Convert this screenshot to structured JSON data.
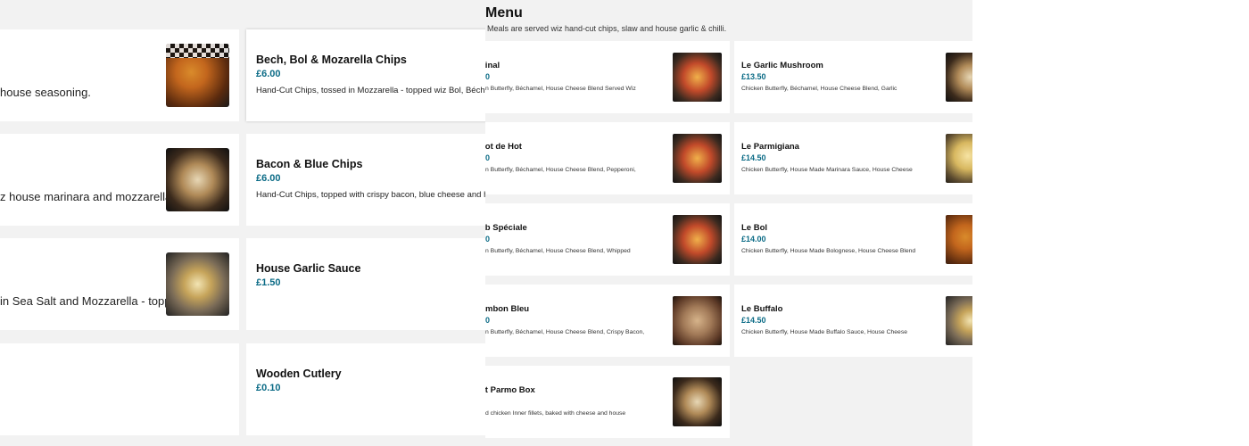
{
  "left": {
    "cards": [
      {
        "title": "Bech, Bol & Mozarella Chips",
        "price": "£6.00",
        "desc": "Hand-Cut Chips, tossed in Mozzarella - topped wiz Bol, Béchamel,"
      },
      {
        "title": "Bacon & Blue Chips",
        "price": "£6.00",
        "desc": "Hand-Cut Chips, topped with crispy bacon, blue cheese and house"
      },
      {
        "title": "House Garlic Sauce",
        "price": "£1.50",
        "desc": ""
      },
      {
        "title": "Wooden Cutlery",
        "price": "£0.10",
        "desc": ""
      }
    ],
    "left_partials": [
      {
        "desc": "house seasoning."
      },
      {
        "desc": "z house marinara and mozzarella"
      },
      {
        "desc": "in Sea Salt and Mozzarella - topped"
      }
    ]
  },
  "right": {
    "menu_title": "Menu",
    "menu_subtitle": "Meals are served wiz hand-cut chips, slaw and house garlic & chilli.",
    "items": [
      {
        "title": "ginal",
        "price": "0",
        "desc": "n Butterfly, Béchamel, House Cheese Blend Served Wiz"
      },
      {
        "title": "Le Garlic Mushroom",
        "price": "£13.50",
        "desc": "Chicken Butterfly, Béchamel, House Cheese Blend, Garlic"
      },
      {
        "title": "hot de Hot",
        "price": "0",
        "desc": "n Butterfly, Béchamel, House Cheese Blend, Pepperoni,"
      },
      {
        "title": "Le Parmigiana",
        "price": "£14.50",
        "desc": "Chicken Butterfly, House Made Marinara Sauce, House Cheese"
      },
      {
        "title": "ub Spéciale",
        "price": "0",
        "desc": "n Butterfly, Béchamel, House Cheese Blend, Whipped"
      },
      {
        "title": "Le Bol",
        "price": "£14.00",
        "desc": "Chicken Butterfly, House Made Bolognese, House Cheese Blend"
      },
      {
        "title": "mbon Bleu",
        "price": "0",
        "desc": "n Butterfly, Béchamel, House Cheese Blend, Crispy Bacon,"
      },
      {
        "title": "Le Buffalo",
        "price": "£14.50",
        "desc": "Chicken Butterfly, House Made Buffalo Sauce, House Cheese"
      },
      {
        "title": "tit Parmo Box",
        "price": "",
        "desc": "d chicken Inner fillets, baked with cheese and house"
      }
    ]
  },
  "colors": {
    "price": "#0b6b86",
    "background": "#f2f2f2",
    "card": "#ffffff"
  },
  "icons": [
    "food-thumbnail"
  ]
}
